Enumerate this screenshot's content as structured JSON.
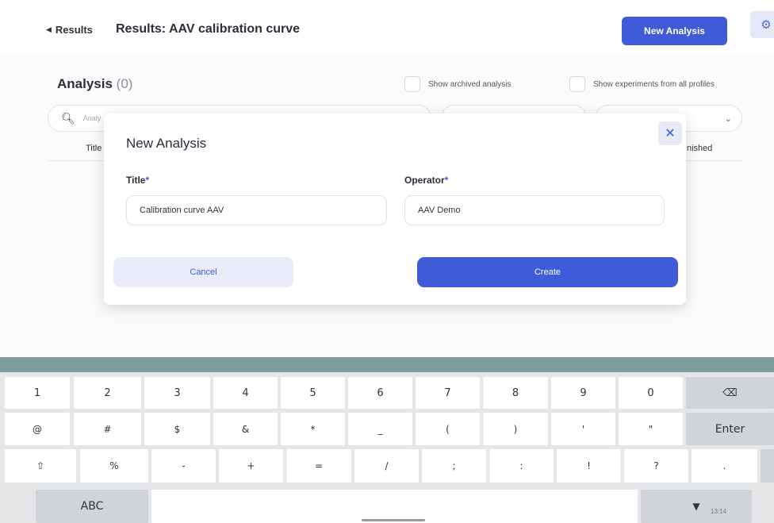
{
  "header": {
    "back_label": "Results",
    "page_title": "Results: AAV  calibration curve",
    "new_analysis_label": "New Analysis",
    "settings_icon": "gear-icon"
  },
  "analysis": {
    "title": "Analysis",
    "count": "(0)",
    "show_archived_label": "Show archived analysis",
    "show_all_profiles_label": "Show experiments from all profiles",
    "search_placeholder": "Analy",
    "columns": [
      "Title",
      "nished"
    ]
  },
  "modal": {
    "title": "New Analysis",
    "title_label": "Title",
    "title_value": "Calibration curve AAV",
    "operator_label": "Operator",
    "operator_value": "AAV Demo",
    "required_mark": "*",
    "cancel_label": "Cancel",
    "create_label": "Create"
  },
  "keyboard": {
    "row1": [
      "1",
      "2",
      "3",
      "4",
      "5",
      "6",
      "7",
      "8",
      "9",
      "0",
      "⌫"
    ],
    "row2": [
      "@",
      "#",
      "$",
      "&",
      "*",
      "_",
      "(",
      ")",
      "'",
      "\"",
      "Enter"
    ],
    "row3": [
      "⇧",
      "%",
      "-",
      "+",
      "=",
      "/",
      ";",
      ":",
      "!",
      "?",
      "."
    ],
    "row4": [
      "ABC",
      "",
      "▼"
    ]
  },
  "status": {
    "time": "13:14"
  },
  "colors": {
    "accent": "#3f5bd8",
    "accent_light": "#e9ecf8",
    "keyboard_bar": "#7f9a9b"
  }
}
